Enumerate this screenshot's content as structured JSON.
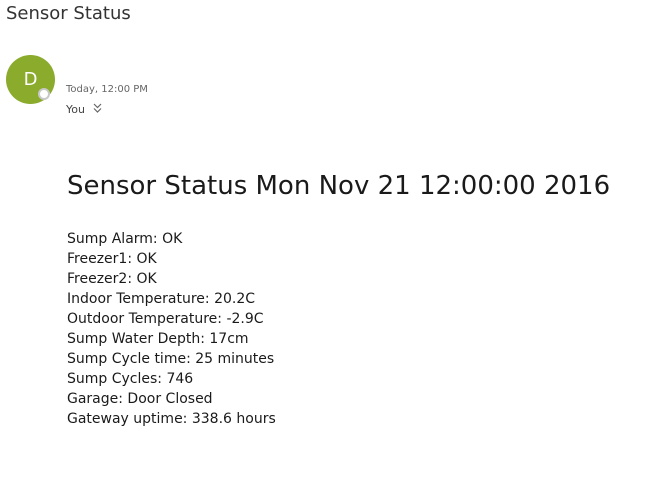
{
  "email": {
    "subject": "Sensor Status",
    "avatar_initial": "D",
    "sender_name": "* * * * * *",
    "timestamp": "Today, 12:00 PM",
    "recipient": "You",
    "recipient_toggle_icon": "double-chevron-down-icon"
  },
  "body": {
    "title": "Sensor Status Mon Nov 21 12:00:00 2016",
    "lines": [
      "Sump Alarm: OK",
      "Freezer1: OK",
      "Freezer2: OK",
      "Indoor Temperature: 20.2C",
      "Outdoor Temperature: -2.9C",
      "Sump Water Depth: 17cm",
      "Sump Cycle time: 25 minutes",
      "Sump Cycles: 746",
      "Garage: Door Closed",
      "Gateway uptime: 338.6 hours"
    ]
  },
  "colors": {
    "avatar_bg": "#8aab2c",
    "text": "#1a1a1a"
  }
}
